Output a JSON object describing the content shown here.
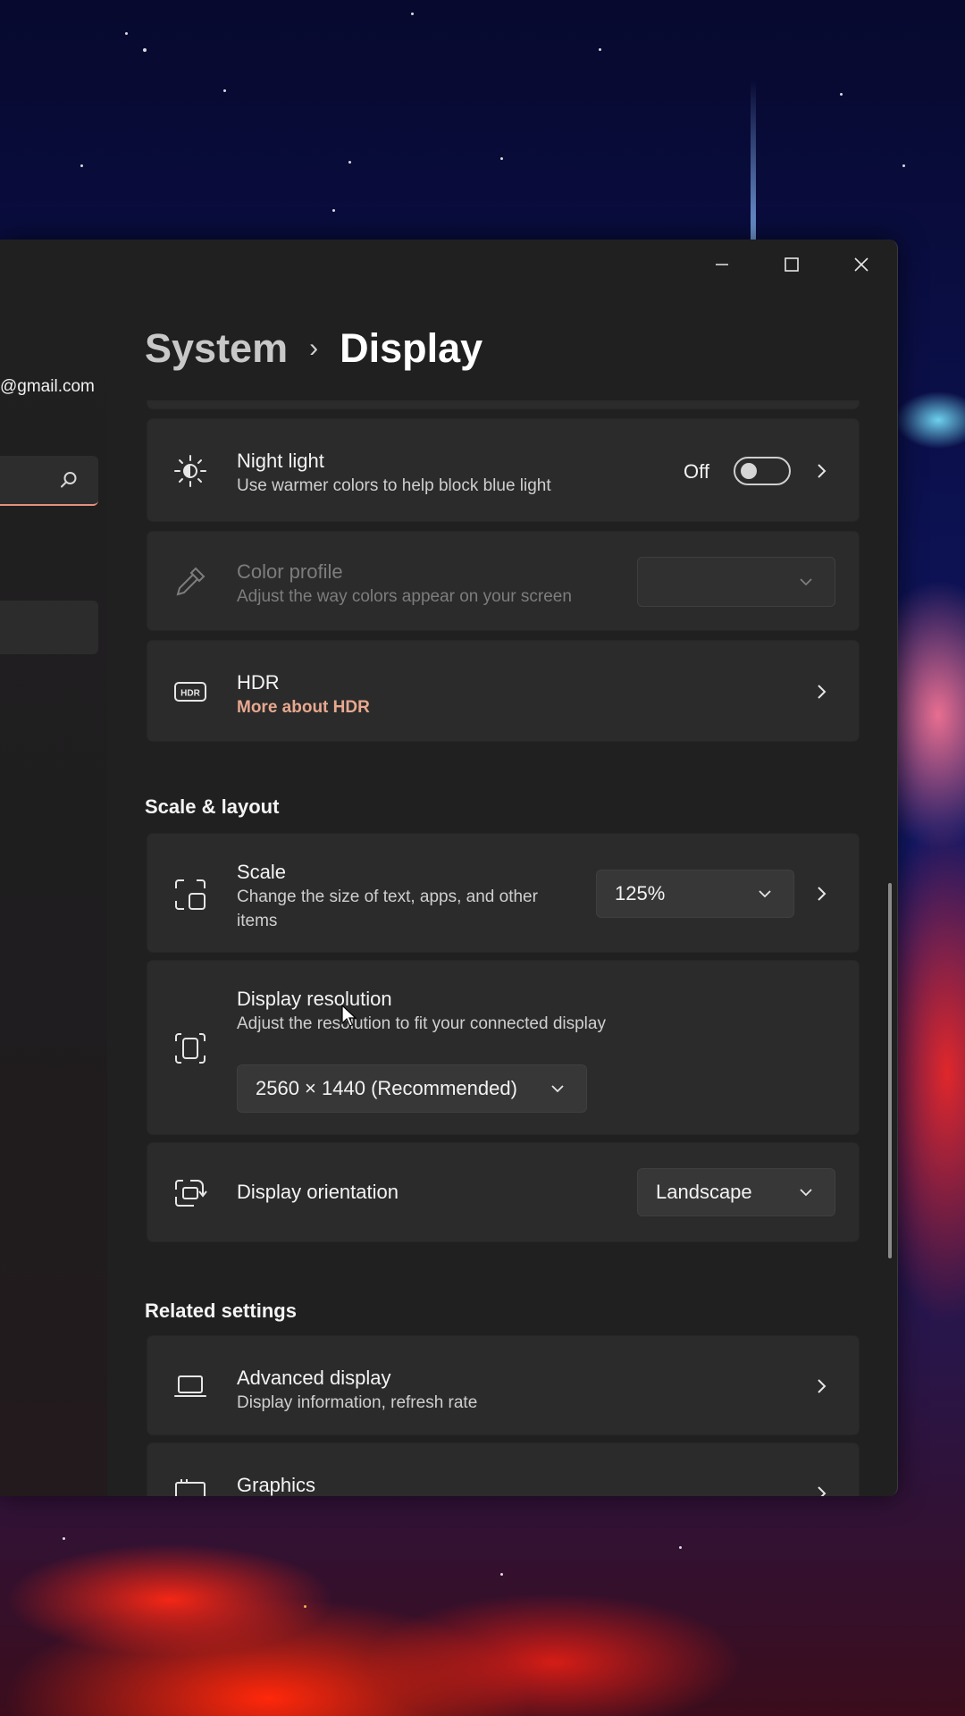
{
  "window": {
    "minimize_icon": "minimize-icon",
    "maximize_icon": "maximize-icon",
    "close_icon": "close-icon"
  },
  "nav": {
    "account_email": "@gmail.com",
    "search_icon": "search-icon"
  },
  "breadcrumb": {
    "parent": "System",
    "separator": "›",
    "current": "Display"
  },
  "night_light": {
    "title": "Night light",
    "subtitle": "Use warmer colors to help block blue light",
    "toggle_state": "Off",
    "toggle_on": false,
    "icon": "brightness-icon"
  },
  "color_profile": {
    "title": "Color profile",
    "subtitle": "Adjust the way colors appear on your screen",
    "selected": "",
    "enabled": false,
    "icon": "eyedropper-icon"
  },
  "hdr": {
    "title": "HDR",
    "link": "More about HDR",
    "icon": "hdr-icon",
    "link_color": "#e8a88f"
  },
  "scale_layout": {
    "header": "Scale & layout",
    "scale": {
      "title": "Scale",
      "subtitle_line1": "Change the size of text, apps, and other",
      "subtitle_line2": "items",
      "value": "125%",
      "icon": "scale-icon"
    },
    "resolution": {
      "title": "Display resolution",
      "subtitle": "Adjust the resolution to fit your connected display",
      "value": "2560 × 1440 (Recommended)",
      "icon": "resolution-icon"
    },
    "orientation": {
      "title": "Display orientation",
      "value": "Landscape",
      "icon": "orientation-icon"
    }
  },
  "related": {
    "header": "Related settings",
    "advanced": {
      "title": "Advanced display",
      "subtitle": "Display information, refresh rate",
      "icon": "laptop-icon"
    },
    "graphics": {
      "title": "Graphics",
      "icon": "graphics-icon"
    }
  },
  "colors": {
    "window_bg": "#202020",
    "card_bg": "#2b2b2b",
    "accent": "#e4917c"
  }
}
